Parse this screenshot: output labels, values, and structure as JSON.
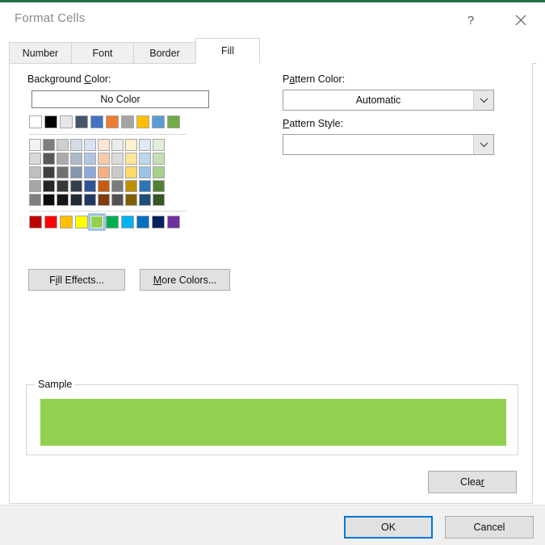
{
  "dialog": {
    "title": "Format Cells",
    "accent_top_color": "#217346",
    "help_icon": "question-mark-icon",
    "close_icon": "close-icon"
  },
  "tabs": [
    {
      "id": "number",
      "label": "Number",
      "active": false
    },
    {
      "id": "font",
      "label": "Font",
      "active": false
    },
    {
      "id": "border",
      "label": "Border",
      "active": false
    },
    {
      "id": "fill",
      "label": "Fill",
      "active": true
    }
  ],
  "fill_tab": {
    "background_color": {
      "label_prefix": "Background ",
      "label_accel": "C",
      "label_suffix": "olor:",
      "no_color_label": "No Color",
      "theme_colors": [
        "#ffffff",
        "#000000",
        "#e7e6e6",
        "#44546a",
        "#4472c4",
        "#ed7d31",
        "#a5a5a5",
        "#ffc000",
        "#5b9bd5",
        "#70ad47"
      ],
      "tint_rows": [
        [
          "#f2f2f2",
          "#7f7f7f",
          "#d0cece",
          "#d6dce4",
          "#d9e2f3",
          "#fbe5d5",
          "#ededed",
          "#fff2cc",
          "#deeaf6",
          "#e2efd9"
        ],
        [
          "#d9d9d9",
          "#595959",
          "#aeaaaa",
          "#acb9ca",
          "#b4c6e7",
          "#f7caac",
          "#dbdbdb",
          "#ffe599",
          "#bdd7ee",
          "#c5e0b3"
        ],
        [
          "#bfbfbf",
          "#404040",
          "#757070",
          "#8496b0",
          "#8eaadb",
          "#f4b083",
          "#c9c9c9",
          "#ffd965",
          "#9cc3e5",
          "#a8d08d"
        ],
        [
          "#a6a6a6",
          "#262626",
          "#3a3838",
          "#333f4f",
          "#2f5496",
          "#c55a11",
          "#7b7b7b",
          "#bf8f00",
          "#2e75b5",
          "#538135"
        ],
        [
          "#808080",
          "#0c0c0c",
          "#171616",
          "#222a35",
          "#1f3864",
          "#833c0b",
          "#525252",
          "#7f6000",
          "#1e4e79",
          "#375623"
        ]
      ],
      "standard_colors": [
        "#c00000",
        "#ff0000",
        "#ffc000",
        "#ffff00",
        "#92d050",
        "#00b050",
        "#00b0f0",
        "#0070c0",
        "#002060",
        "#7030a0"
      ],
      "selected_standard_index": 4,
      "selected_color": "#92d050"
    },
    "fill_effects_button": {
      "prefix": "F",
      "accel": "i",
      "suffix": "ll Effects..."
    },
    "more_colors_button": {
      "prefix": "",
      "accel": "M",
      "suffix": "ore Colors..."
    },
    "pattern_color": {
      "label_prefix": "P",
      "label_accel": "a",
      "label_suffix": "ttern Color:",
      "value": "Automatic",
      "dropdown_icon": "chevron-down-icon"
    },
    "pattern_style": {
      "label_prefix": "",
      "label_accel": "P",
      "label_suffix": "attern Style:",
      "value": "",
      "dropdown_icon": "chevron-down-icon"
    },
    "sample": {
      "legend": "Sample",
      "swatch_color": "#92d050"
    },
    "clear_button": {
      "prefix": "Clea",
      "accel": "r",
      "suffix": ""
    }
  },
  "footer": {
    "ok_label": "OK",
    "cancel_label": "Cancel",
    "focus_color": "#0078d7"
  }
}
